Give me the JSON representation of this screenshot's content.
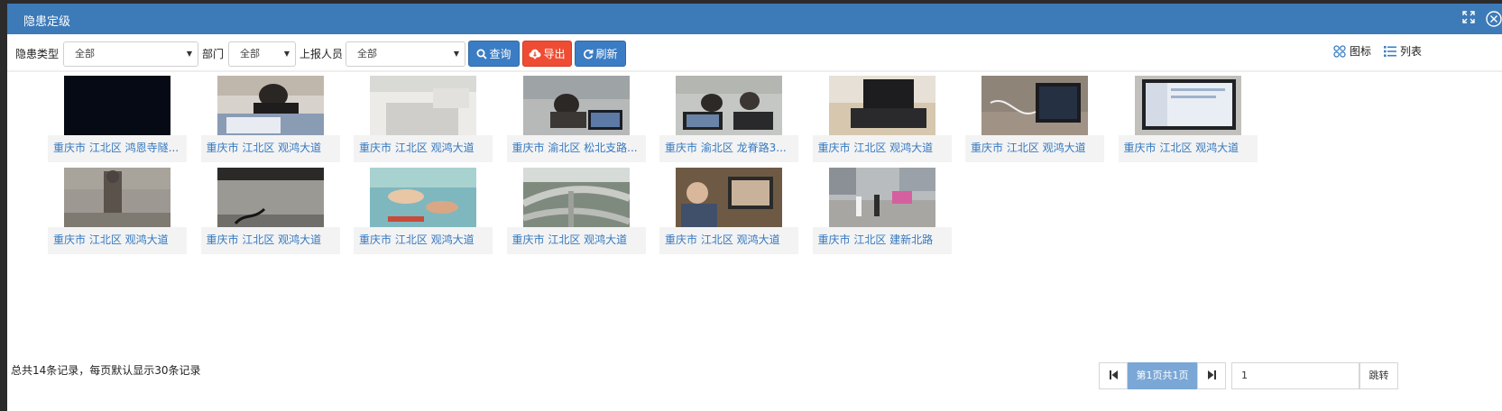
{
  "window": {
    "title": "隐患定级",
    "icons": [
      "expand-icon",
      "close-icon"
    ]
  },
  "filters": {
    "type_label": "隐患类型",
    "type_value": "全部",
    "dept_label": "部门",
    "dept_value": "全部",
    "reporter_label": "上报人员",
    "reporter_value": "全部"
  },
  "buttons": {
    "query": "查询",
    "export": "导出",
    "refresh": "刷新"
  },
  "view": {
    "icon_label": "图标",
    "list_label": "列表"
  },
  "items": [
    {
      "caption": "重庆市 江北区 鸿恩寺隧...",
      "thumb": "dark"
    },
    {
      "caption": "重庆市 江北区 观鸿大道",
      "thumb": "person-desk"
    },
    {
      "caption": "重庆市 江北区 观鸿大道",
      "thumb": "white-room"
    },
    {
      "caption": "重庆市 渝北区 松北支路...",
      "thumb": "office"
    },
    {
      "caption": "重庆市 渝北区 龙脊路3...",
      "thumb": "office2"
    },
    {
      "caption": "重庆市 江北区 观鸿大道",
      "thumb": "laptop-desk"
    },
    {
      "caption": "重庆市 江北区 观鸿大道",
      "thumb": "laptop-cables"
    },
    {
      "caption": "重庆市 江北区 观鸿大道",
      "thumb": "laptop-screen"
    },
    {
      "caption": "重庆市 江北区 观鸿大道",
      "thumb": "statue"
    },
    {
      "caption": "重庆市 江北区 观鸿大道",
      "thumb": "floor-cable"
    },
    {
      "caption": "重庆市 江北区 观鸿大道",
      "thumb": "painting"
    },
    {
      "caption": "重庆市 江北区 观鸿大道",
      "thumb": "overpass"
    },
    {
      "caption": "重庆市 江北区 观鸿大道",
      "thumb": "man-monitor"
    },
    {
      "caption": "重庆市 江北区 建新北路",
      "thumb": "street"
    }
  ],
  "footer": {
    "summary": "总共14条记录，每页默认显示30条记录"
  },
  "pagination": {
    "current": "第1页共1页",
    "page_input": "1",
    "jump": "跳转"
  },
  "colors": {
    "titlebar": "#3d7ab8",
    "primary": "#3b7dc4",
    "danger": "#ee4d33",
    "link": "#3579c0"
  }
}
